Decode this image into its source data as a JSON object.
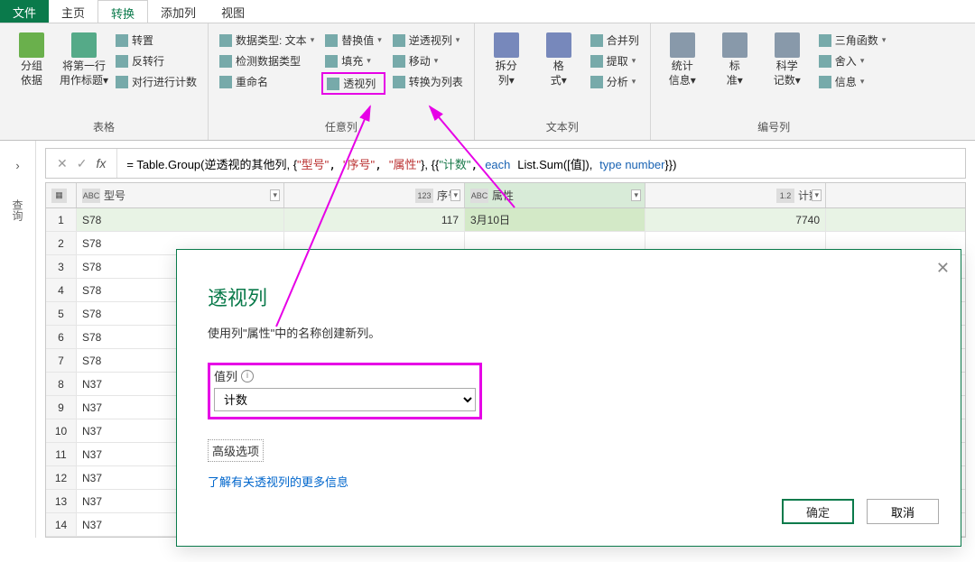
{
  "menu": {
    "file": "文件",
    "home": "主页",
    "transform": "转换",
    "addcol": "添加列",
    "view": "视图"
  },
  "ribbon": {
    "g_table": {
      "label": "表格",
      "groupby": "分组\n依据",
      "firstrow": "将第一行\n用作标题",
      "transpose": "转置",
      "reverse": "反转行",
      "countrows": "对行进行计数"
    },
    "g_anycol": {
      "label": "任意列",
      "datatype": "数据类型: 文本",
      "detect": "检测数据类型",
      "rename": "重命名",
      "replace": "替换值",
      "fill": "填充",
      "pivot": "透视列",
      "unpivot": "逆透视列",
      "move": "移动",
      "tolist": "转换为列表"
    },
    "g_textcol": {
      "label": "文本列",
      "split": "拆分\n列",
      "format": "格\n式",
      "merge": "合并列",
      "extract": "提取",
      "parse": "分析"
    },
    "g_numcol": {
      "label": "编号列",
      "stats": "统计\n信息",
      "standard": "标\n准",
      "sci": "科学\n记数",
      "trig": "三角函数",
      "round": "舍入",
      "info": "信息"
    }
  },
  "sidebar": {
    "queries": "查询"
  },
  "formula": {
    "prefix": "= Table.Group(逆透视的其他列, {",
    "cols": [
      "\"型号\"",
      "\"序号\"",
      "\"属性\""
    ],
    "mid": "}, {{",
    "agg_name": "\"计数\"",
    "each": "each",
    "fn": "List.Sum",
    "arg": "([值]),",
    "type": "type number",
    "end": "}})"
  },
  "grid": {
    "headers": {
      "c0_type": "ABC",
      "c0": "型号",
      "c1_type": "123",
      "c1": "序号",
      "c2_type": "ABC",
      "c2": "属性",
      "c3_type": "1.2",
      "c3": "计数"
    },
    "rows": [
      {
        "i": "1",
        "a": "S78",
        "b": "117",
        "c": "3月10日",
        "d": "7740"
      },
      {
        "i": "2",
        "a": "S78",
        "b": "",
        "c": "",
        "d": ""
      },
      {
        "i": "3",
        "a": "S78",
        "b": "",
        "c": "",
        "d": ""
      },
      {
        "i": "4",
        "a": "S78",
        "b": "",
        "c": "",
        "d": ""
      },
      {
        "i": "5",
        "a": "S78",
        "b": "",
        "c": "",
        "d": ""
      },
      {
        "i": "6",
        "a": "S78",
        "b": "",
        "c": "",
        "d": ""
      },
      {
        "i": "7",
        "a": "S78",
        "b": "",
        "c": "",
        "d": ""
      },
      {
        "i": "8",
        "a": "N37",
        "b": "",
        "c": "",
        "d": ""
      },
      {
        "i": "9",
        "a": "N37",
        "b": "",
        "c": "",
        "d": ""
      },
      {
        "i": "10",
        "a": "N37",
        "b": "",
        "c": "",
        "d": ""
      },
      {
        "i": "11",
        "a": "N37",
        "b": "",
        "c": "",
        "d": ""
      },
      {
        "i": "12",
        "a": "N37",
        "b": "",
        "c": "",
        "d": ""
      },
      {
        "i": "13",
        "a": "N37",
        "b": "",
        "c": "",
        "d": ""
      },
      {
        "i": "14",
        "a": "N37",
        "b": "",
        "c": "",
        "d": ""
      }
    ]
  },
  "dialog": {
    "title": "透视列",
    "desc_a": "使用列\"属",
    "desc_b": "性\"中的名称创建新列。",
    "value_label": "值列",
    "value_selected": "计数",
    "advanced": "高级选项",
    "more": "了解有关透视列的更多信息",
    "ok": "确定",
    "cancel": "取消"
  }
}
